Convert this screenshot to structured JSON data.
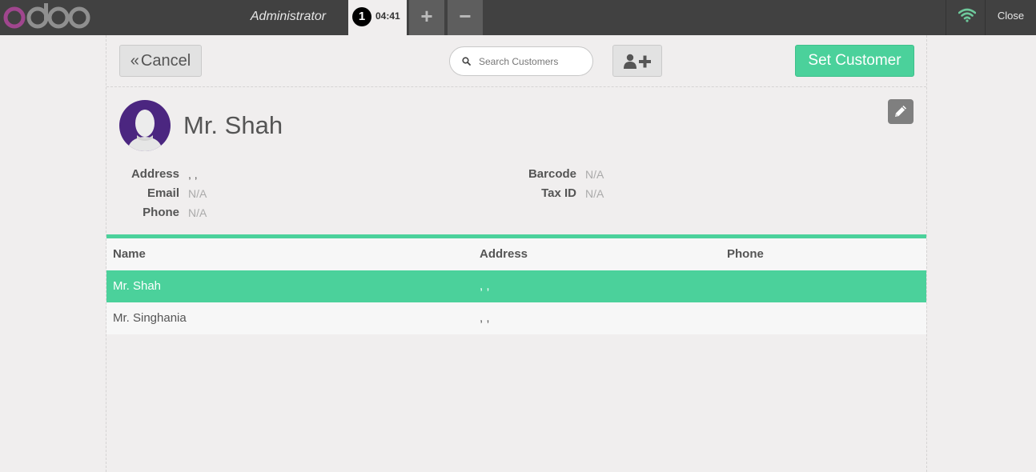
{
  "topbar": {
    "username": "Administrator",
    "order_seq": "1",
    "order_time": "04:41",
    "add_order": "+",
    "remove_order": "−",
    "close": "Close",
    "colors": {
      "bar": "#414141",
      "wifi": "#6ec89b",
      "logo_o": "#a0468e"
    }
  },
  "toolbar": {
    "cancel_label": "Cancel",
    "search_placeholder": "Search Customers",
    "set_customer_label": "Set Customer"
  },
  "client": {
    "name": "Mr. Shah",
    "fields_left": [
      {
        "label": "Address",
        "value": ", ,"
      },
      {
        "label": "Email",
        "value": "N/A"
      },
      {
        "label": "Phone",
        "value": "N/A"
      }
    ],
    "fields_right": [
      {
        "label": "Barcode",
        "value": "N/A"
      },
      {
        "label": "Tax ID",
        "value": "N/A"
      }
    ]
  },
  "table": {
    "headers": [
      "Name",
      "Address",
      "Phone"
    ],
    "rows": [
      {
        "name": "Mr. Shah",
        "address": ", ,",
        "phone": ""
      },
      {
        "name": "Mr. Singhania",
        "address": ", ,",
        "phone": ""
      }
    ]
  },
  "accent": "#4bd19b",
  "icons": [
    "logo-icon",
    "wifi-icon",
    "search-icon",
    "add-user-icon",
    "avatar-icon",
    "pencil-icon",
    "double-chevron-left-icon"
  ]
}
